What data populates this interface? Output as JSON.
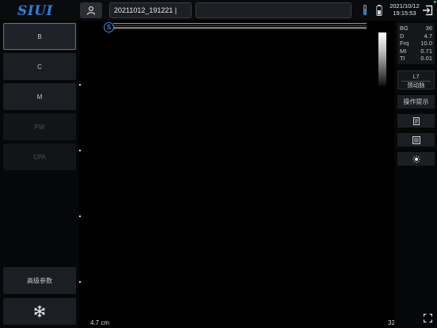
{
  "header": {
    "logo": "SIUI",
    "patient_id": "20211012_191221 |",
    "info_field": "",
    "date": "2021/10/12",
    "time": "19:15:53"
  },
  "left_panel": {
    "modes": [
      {
        "label": "B",
        "state": "selected"
      },
      {
        "label": "C",
        "state": "normal"
      },
      {
        "label": "M",
        "state": "normal"
      },
      {
        "label": "PW",
        "state": "disabled"
      },
      {
        "label": "CPA",
        "state": "disabled"
      }
    ],
    "advanced_label": "高级参数",
    "freeze_icon": "snowflake-icon"
  },
  "image": {
    "badge": "S",
    "depth": "4.7 cm",
    "frame": "32"
  },
  "right_panel": {
    "params": [
      {
        "name": "BG",
        "value": "36"
      },
      {
        "name": "D",
        "value": "4.7"
      },
      {
        "name": "Frq",
        "value": "10.0"
      },
      {
        "name": "MI",
        "value": "0.71"
      },
      {
        "name": "TI",
        "value": "0.01"
      }
    ],
    "probe": "L7",
    "preset": "颈动脉",
    "op_hint": "操作提示",
    "icons": [
      "report-icon",
      "list-icon",
      "brightness-icon"
    ]
  },
  "colors": {
    "accent": "#2b7fd8",
    "selected_border": "#4a78b8",
    "status_green": "#26c26b"
  }
}
